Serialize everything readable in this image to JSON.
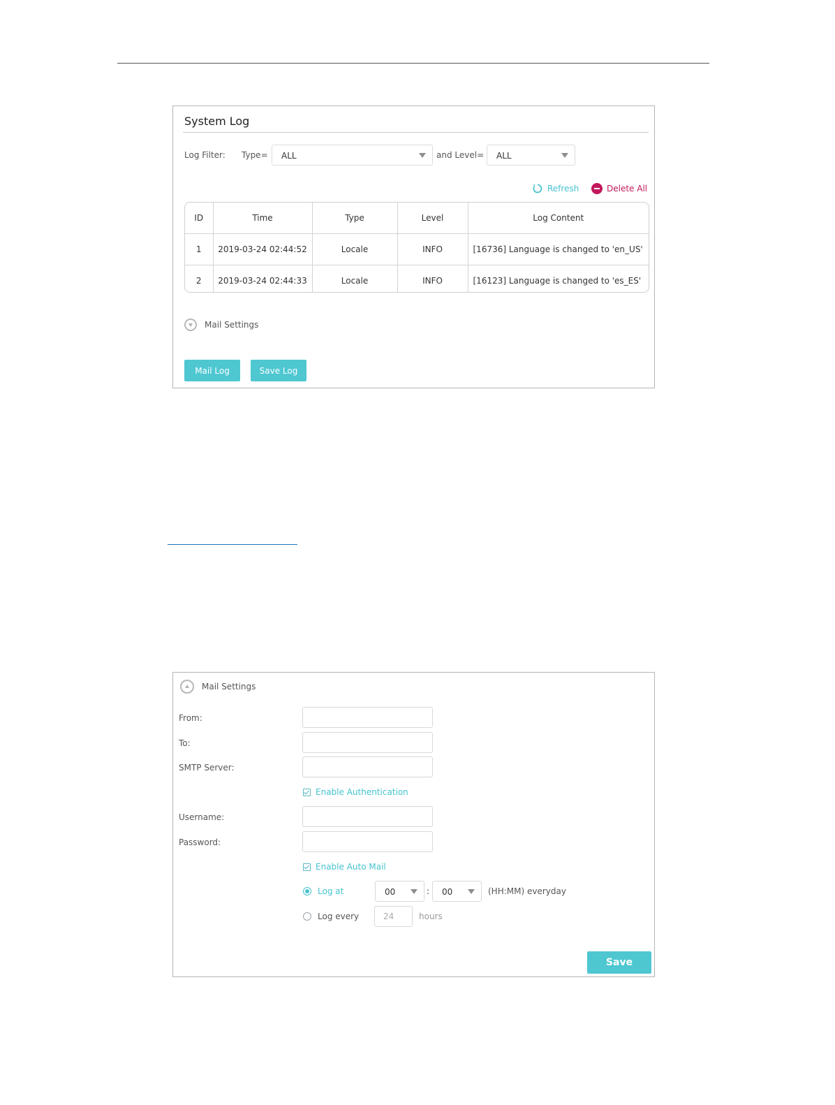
{
  "system_log": {
    "title": "System Log",
    "filter": {
      "label": "Log Filter:",
      "type_label": "Type=",
      "type_value": "ALL",
      "level_label": "and Level=",
      "level_value": "ALL"
    },
    "actions": {
      "refresh": "Refresh",
      "delete_all": "Delete All"
    },
    "table": {
      "headers": [
        "ID",
        "Time",
        "Type",
        "Level",
        "Log Content"
      ],
      "rows": [
        [
          "1",
          "2019-03-24 02:44:52",
          "Locale",
          "INFO",
          "[16736] Language is changed to 'en_US'"
        ],
        [
          "2",
          "2019-03-24 02:44:33",
          "Locale",
          "INFO",
          "[16123] Language is changed to 'es_ES'"
        ]
      ]
    },
    "mail_settings_toggle": "Mail Settings",
    "buttons": {
      "mail_log": "Mail Log",
      "save_log": "Save Log"
    }
  },
  "mail_settings": {
    "title": "Mail Settings",
    "labels": {
      "from": "From:",
      "to": "To:",
      "smtp": "SMTP Server:",
      "username": "Username:",
      "password": "Password:"
    },
    "values": {
      "from": "",
      "to": "",
      "smtp": "",
      "username": "",
      "password": ""
    },
    "enable_auth": "Enable Authentication",
    "enable_auto_mail": "Enable Auto Mail",
    "log_at": {
      "label": "Log at",
      "hour": "00",
      "separator": ":",
      "minute": "00",
      "suffix": "(HH:MM) everyday"
    },
    "log_every": {
      "label": "Log every",
      "value": "24",
      "suffix": "hours"
    },
    "save": "Save"
  },
  "colors": {
    "accent": "#4ec7d1",
    "danger": "#c2185b"
  }
}
